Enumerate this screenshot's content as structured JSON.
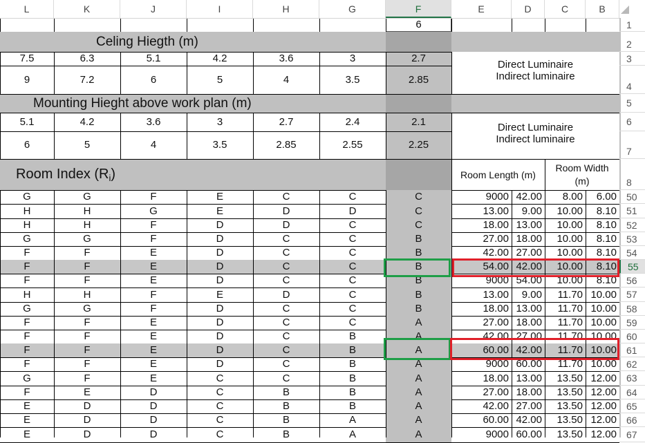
{
  "columns": [
    "L",
    "K",
    "J",
    "I",
    "H",
    "G",
    "F",
    "E",
    "D",
    "C",
    "B"
  ],
  "selected_column": "F",
  "selected_row": "55",
  "rows": [
    "1",
    "2",
    "3",
    "4",
    "5",
    "6",
    "7",
    "8",
    "50",
    "51",
    "52",
    "53",
    "54",
    "55",
    "56",
    "57",
    "58",
    "59",
    "60",
    "61",
    "62",
    "63",
    "64",
    "65",
    "66",
    "67"
  ],
  "top": {
    "f1_value": "6",
    "ceiling_title": "Celing Hiegth (m)",
    "ceiling_row3": [
      "7.5",
      "6.3",
      "5.1",
      "4.2",
      "3.6",
      "3",
      "2.7"
    ],
    "ceiling_row4": [
      "9",
      "7.2",
      "6",
      "5",
      "4",
      "3.5",
      "2.85"
    ],
    "direct_label": "Direct Luminaire",
    "indirect_label": "Indirect luminaire",
    "mounting_title": "Mounting Hieght above work plan (m)",
    "mounting_row6": [
      "5.1",
      "4.2",
      "3.6",
      "3",
      "2.7",
      "2.4",
      "2.1"
    ],
    "mounting_row7": [
      "6",
      "5",
      "4",
      "3.5",
      "2.85",
      "2.55",
      "2.25"
    ],
    "direct_label2": "Direct Luminaire",
    "indirect_label2": "Indirect luminaire",
    "room_index_title": "Room Index (R",
    "room_index_sub": "i",
    "room_index_close": ")",
    "room_length_header": "Room Length (m)",
    "room_width_header_1": "Room Width",
    "room_width_header_2": "(m)"
  },
  "table": [
    [
      "G",
      "G",
      "F",
      "E",
      "C",
      "C",
      "C",
      "9000",
      "42.00",
      "8.00",
      "6.00"
    ],
    [
      "H",
      "H",
      "G",
      "E",
      "D",
      "D",
      "C",
      "13.00",
      "9.00",
      "10.00",
      "8.10"
    ],
    [
      "H",
      "H",
      "F",
      "D",
      "D",
      "C",
      "C",
      "18.00",
      "13.00",
      "10.00",
      "8.10"
    ],
    [
      "G",
      "G",
      "F",
      "D",
      "C",
      "C",
      "B",
      "27.00",
      "18.00",
      "10.00",
      "8.10"
    ],
    [
      "F",
      "F",
      "E",
      "D",
      "C",
      "C",
      "B",
      "42.00",
      "27.00",
      "10.00",
      "8.10"
    ],
    [
      "F",
      "F",
      "E",
      "D",
      "C",
      "C",
      "B",
      "54.00",
      "42.00",
      "10.00",
      "8.10"
    ],
    [
      "F",
      "F",
      "E",
      "D",
      "C",
      "C",
      "B",
      "9000",
      "54.00",
      "10.00",
      "8.10"
    ],
    [
      "H",
      "H",
      "F",
      "E",
      "D",
      "C",
      "B",
      "13.00",
      "9.00",
      "11.70",
      "10.00"
    ],
    [
      "G",
      "G",
      "F",
      "D",
      "C",
      "C",
      "B",
      "18.00",
      "13.00",
      "11.70",
      "10.00"
    ],
    [
      "F",
      "F",
      "E",
      "D",
      "C",
      "C",
      "A",
      "27.00",
      "18.00",
      "11.70",
      "10.00"
    ],
    [
      "F",
      "F",
      "E",
      "D",
      "C",
      "B",
      "A",
      "42.00",
      "27.00",
      "11.70",
      "10.00"
    ],
    [
      "F",
      "F",
      "E",
      "D",
      "C",
      "B",
      "A",
      "60.00",
      "42.00",
      "11.70",
      "10.00"
    ],
    [
      "F",
      "F",
      "E",
      "D",
      "C",
      "B",
      "A",
      "9000",
      "60.00",
      "11.70",
      "10.00"
    ],
    [
      "G",
      "F",
      "E",
      "C",
      "C",
      "B",
      "A",
      "18.00",
      "13.00",
      "13.50",
      "12.00"
    ],
    [
      "F",
      "E",
      "D",
      "C",
      "B",
      "B",
      "A",
      "27.00",
      "18.00",
      "13.50",
      "12.00"
    ],
    [
      "E",
      "D",
      "D",
      "C",
      "B",
      "B",
      "A",
      "42.00",
      "27.00",
      "13.50",
      "12.00"
    ],
    [
      "E",
      "D",
      "D",
      "C",
      "B",
      "A",
      "A",
      "60.00",
      "42.00",
      "13.50",
      "12.00"
    ],
    [
      "E",
      "D",
      "D",
      "C",
      "B",
      "A",
      "A",
      "9000",
      "60.00",
      "13.50",
      "12.00"
    ]
  ],
  "colors": {
    "highlight_green": "#1e9e47",
    "highlight_red": "#e0202a",
    "band_gray": "#c0c0c0",
    "dark_gray": "#a6a6a6"
  }
}
